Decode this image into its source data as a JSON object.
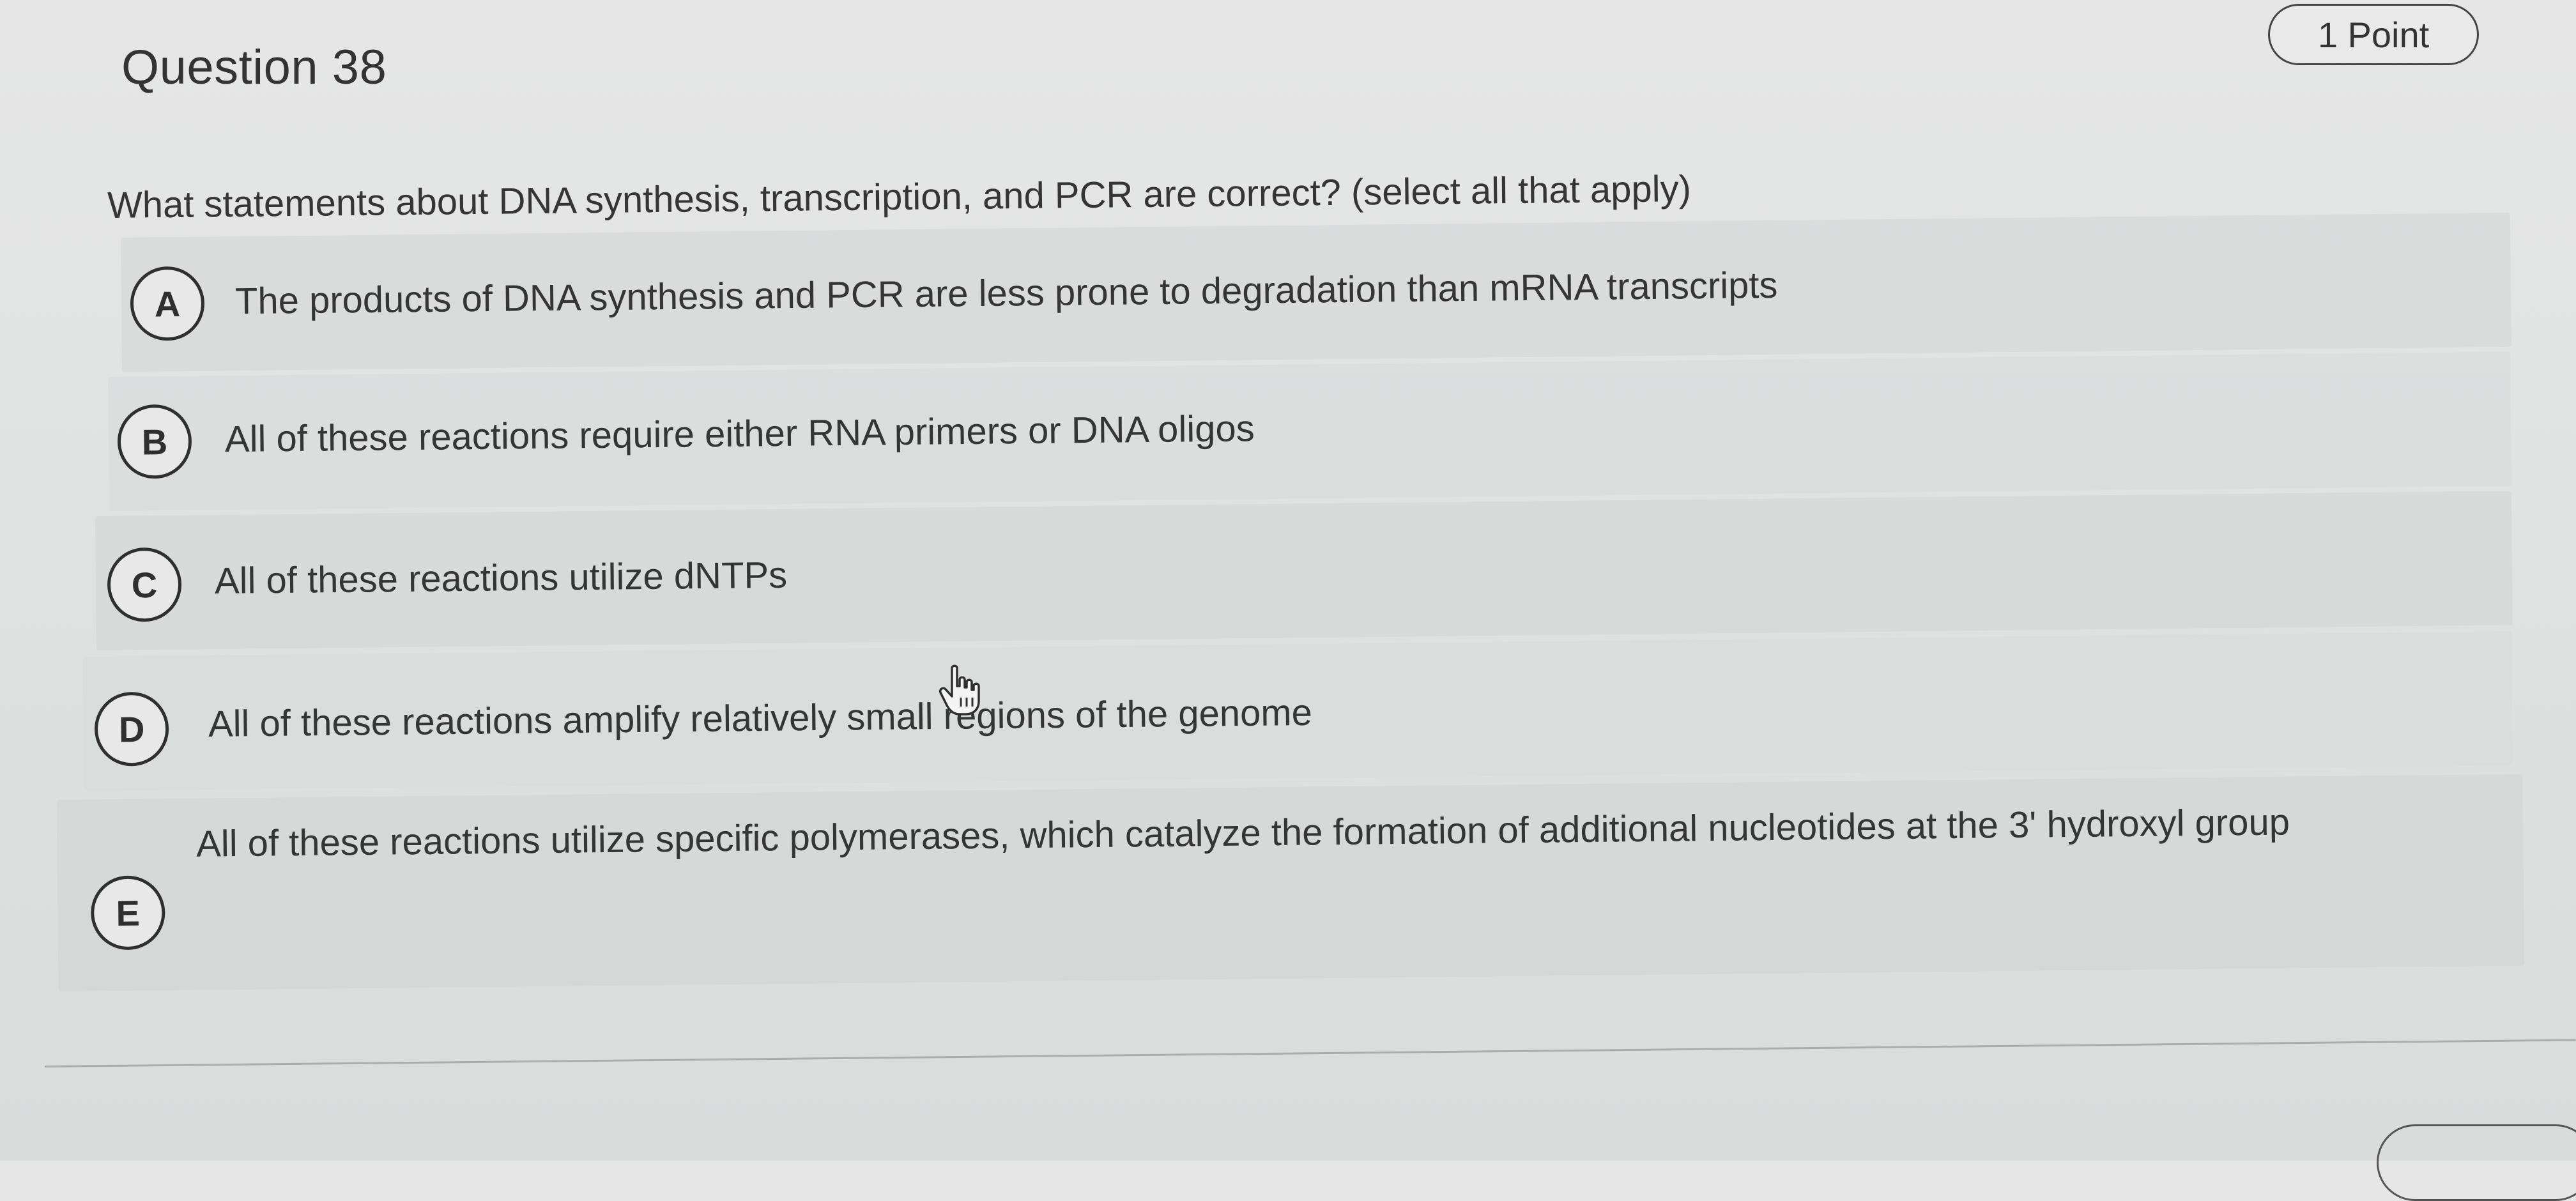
{
  "question": {
    "title": "Question 38",
    "points": "1 Point",
    "prompt": "What statements about DNA synthesis, transcription, and PCR are correct? (select all that apply)"
  },
  "choices": [
    {
      "letter": "A",
      "text": "The products of DNA synthesis and PCR are less prone to degradation than mRNA transcripts"
    },
    {
      "letter": "B",
      "text": "All of these reactions require either RNA primers or DNA oligos"
    },
    {
      "letter": "C",
      "text": "All of these reactions utilize dNTPs"
    },
    {
      "letter": "D",
      "text": "All of these reactions amplify relatively small regions of the genome"
    },
    {
      "letter": "E",
      "text": "All of these reactions utilize specific polymerases, which catalyze the formation of additional nucleotides at the 3' hydroxyl group"
    }
  ],
  "icons": {
    "cursor": "hand-pointer-icon"
  },
  "colors": {
    "text": "#353535",
    "background": "#e1e3e3",
    "row_shade": "#cfd3d1",
    "badge_border": "#444444"
  }
}
